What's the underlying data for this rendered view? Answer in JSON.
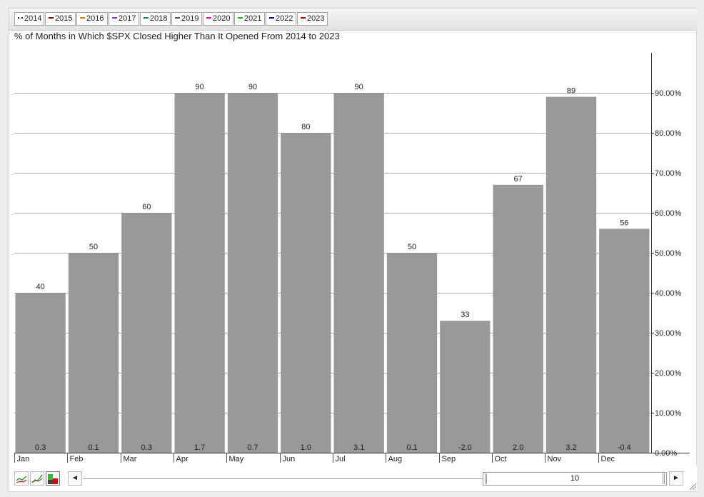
{
  "legend": {
    "items": [
      {
        "label": "2014",
        "color": "#222222",
        "style": "dotted"
      },
      {
        "label": "2015",
        "color": "#8b0000",
        "style": "solid"
      },
      {
        "label": "2016",
        "color": "#e07b00",
        "style": "solid"
      },
      {
        "label": "2017",
        "color": "#8a2be2",
        "style": "solid"
      },
      {
        "label": "2018",
        "color": "#008b8b",
        "style": "solid"
      },
      {
        "label": "2019",
        "color": "#555555",
        "style": "solid"
      },
      {
        "label": "2020",
        "color": "#ff00aa",
        "style": "solid"
      },
      {
        "label": "2021",
        "color": "#00cc00",
        "style": "solid"
      },
      {
        "label": "2022",
        "color": "#00008b",
        "style": "solid"
      },
      {
        "label": "2023",
        "color": "#cc0000",
        "style": "solid"
      }
    ]
  },
  "chart_data": {
    "type": "bar",
    "title": "% of Months in Which $SPX Closed Higher Than It Opened From 2014 to 2023",
    "categories": [
      "Jan",
      "Feb",
      "Mar",
      "Apr",
      "May",
      "Jun",
      "Jul",
      "Aug",
      "Sep",
      "Oct",
      "Nov",
      "Dec"
    ],
    "values": [
      40,
      50,
      60,
      90,
      90,
      80,
      90,
      50,
      33,
      67,
      89,
      56
    ],
    "bottom_labels": [
      "0.3",
      "0.1",
      "0.3",
      "1.7",
      "0.7",
      "1.0",
      "3.1",
      "0.1",
      "-2.0",
      "2.0",
      "3.2",
      "-0.4"
    ],
    "ylim": [
      0,
      100
    ],
    "y_ticks": [
      0,
      10,
      20,
      30,
      40,
      50,
      60,
      70,
      80,
      90
    ],
    "y_tick_labels": [
      "0.00%",
      "10.00%",
      "20.00%",
      "30.00%",
      "40.00%",
      "50.00%",
      "60.00%",
      "70.00%",
      "80.00%",
      "90.00%"
    ],
    "y_axis_side": "right",
    "grid": true,
    "bar_color": "#999999",
    "legend_placement": "top"
  },
  "scroller": {
    "prev_label": "◄",
    "next_label": "►",
    "thumb_label": "10"
  },
  "toolbar": {
    "icons": [
      "line-chart-icon",
      "area-chart-icon",
      "bar-chart-icon"
    ]
  }
}
